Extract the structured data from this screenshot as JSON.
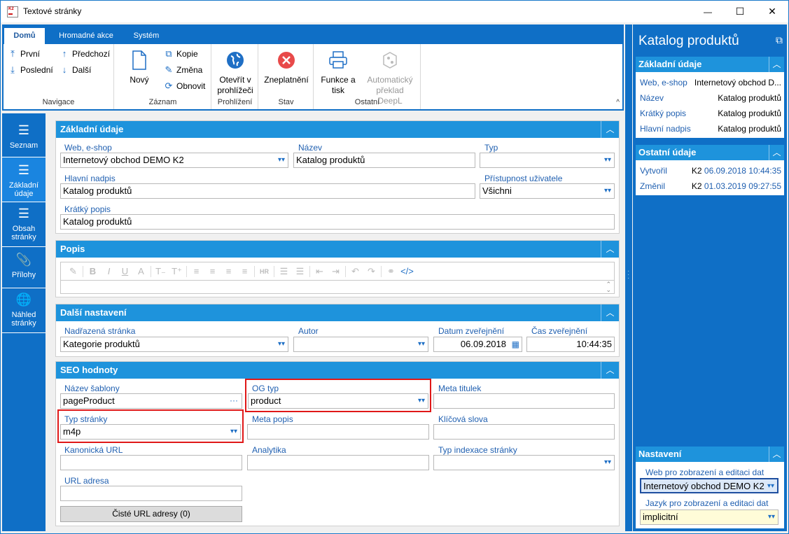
{
  "window": {
    "title": "Textové stránky",
    "minimize": "—",
    "maximize": "☐",
    "close": "✕"
  },
  "ribbon": {
    "tabs": [
      "Domů",
      "Hromadné akce",
      "Systém"
    ],
    "groups": {
      "navigace": {
        "label": "Navigace",
        "first": "První",
        "prev": "Předchozí",
        "last": "Poslední",
        "next": "Další"
      },
      "zaznam": {
        "label": "Záznam",
        "new": "Nový",
        "copy": "Kopie",
        "change": "Změna",
        "refresh": "Obnovit"
      },
      "prohlizeni": {
        "label": "Prohlížení",
        "open": "Otevřít v prohlížeči"
      },
      "stav": {
        "label": "Stav",
        "invalidate": "Zneplatnění"
      },
      "ostatni": {
        "label": "Ostatní",
        "print": "Funkce a tisk",
        "deepl": "Automatický překlad DeepL"
      }
    },
    "collapse": "^"
  },
  "leftnav": {
    "items": [
      {
        "label": "Seznam"
      },
      {
        "label": "Základní údaje"
      },
      {
        "label": "Obsah stránky"
      },
      {
        "label": "Přílohy"
      },
      {
        "label": "Náhled stránky"
      }
    ]
  },
  "zakladni": {
    "title": "Základní údaje",
    "web_label": "Web, e-shop",
    "web_value": "Internetový obchod DEMO K2",
    "nazev_label": "Název",
    "nazev_value": "Katalog produktů",
    "typ_label": "Typ",
    "typ_value": "",
    "nadpis_label": "Hlavní nadpis",
    "nadpis_value": "Katalog produktů",
    "pristupnost_label": "Přístupnost uživatele",
    "pristupnost_value": "Všichni",
    "kratky_label": "Krátký popis",
    "kratky_value": "Katalog produktů"
  },
  "popis": {
    "title": "Popis"
  },
  "dalsi": {
    "title": "Další nastavení",
    "nadrazena_label": "Nadřazená stránka",
    "nadrazena_value": "Kategorie produktů",
    "autor_label": "Autor",
    "autor_value": "",
    "datum_label": "Datum zveřejnění",
    "datum_value": "06.09.2018",
    "cas_label": "Čas zveřejnění",
    "cas_value": "10:44:35"
  },
  "seo": {
    "title": "SEO hodnoty",
    "sablona_label": "Název šablony",
    "sablona_value": "pageProduct",
    "ogtyp_label": "OG typ",
    "ogtyp_value": "product",
    "metatitulek_label": "Meta titulek",
    "metatitulek_value": "",
    "typstranky_label": "Typ stránky",
    "typstranky_value": "m4p",
    "metapopis_label": "Meta popis",
    "metapopis_value": "",
    "klicova_label": "Klíčová slova",
    "klicova_value": "",
    "kanonicka_label": "Kanonická URL",
    "kanonicka_value": "",
    "analytika_label": "Analytika",
    "analytika_value": "",
    "indexace_label": "Typ indexace stránky",
    "indexace_value": "",
    "url_label": "URL adresa",
    "url_value": "",
    "ciste_button": "Čisté URL adresy (0)"
  },
  "right": {
    "title": "Katalog produktů",
    "zakladni": {
      "title": "Základní údaje",
      "rows": [
        {
          "k": "Web, e-shop",
          "v": "Internetový obchod D..."
        },
        {
          "k": "Název",
          "v": "Katalog produktů"
        },
        {
          "k": "Krátký popis",
          "v": "Katalog produktů"
        },
        {
          "k": "Hlavní nadpis",
          "v": "Katalog produktů"
        }
      ]
    },
    "ostatni": {
      "title": "Ostatní údaje",
      "rows": [
        {
          "k": "Vytvořil",
          "user": "K2",
          "date": "06.09.2018 10:44:35"
        },
        {
          "k": "Změnil",
          "user": "K2",
          "date": "01.03.2019 09:27:55"
        }
      ]
    },
    "nastaveni": {
      "title": "Nastavení",
      "web_label": "Web pro zobrazení a editaci dat",
      "web_value": "Internetový obchod DEMO K2",
      "jazyk_label": "Jazyk pro zobrazení a editaci dat",
      "jazyk_value": "implicitní"
    }
  },
  "colors": {
    "accent": "#0f6fc6",
    "panelHeader": "#1e93dc",
    "highlight": "#e01818",
    "label": "#1f5fb0"
  }
}
